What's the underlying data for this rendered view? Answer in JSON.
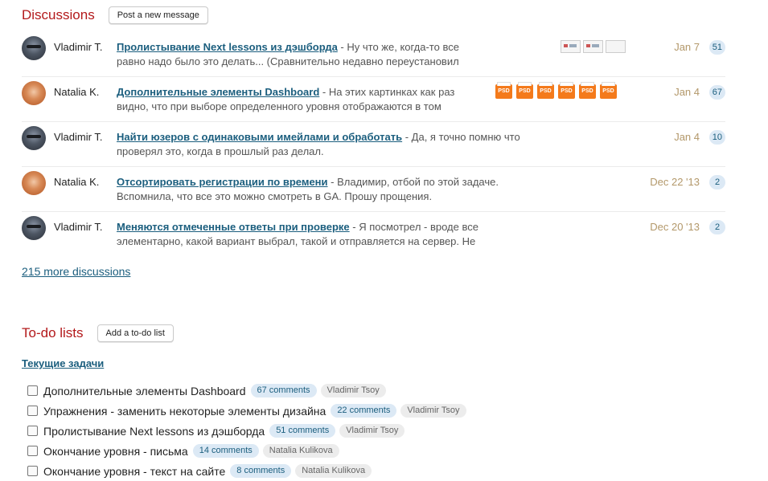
{
  "discussions": {
    "title": "Discussions",
    "post_button": "Post a new message",
    "items": [
      {
        "author": "Vladimir T.",
        "subject": "Пролистывание Next lessons из дэшборда",
        "excerpt": " - Ну что же, когда-то все равно надо было это делать... (Сравнительно недавно переустановил систему; а у меня",
        "date": "Jan 7",
        "count": "51"
      },
      {
        "author": "Natalia K.",
        "subject": "Дополнительные элементы Dashboard",
        "excerpt": " - На этих картинках как раз видно, что при выборе определенного уровня отображаются в том",
        "date": "Jan 4",
        "count": "67",
        "attachment_label": "PSD"
      },
      {
        "author": "Vladimir T.",
        "subject": "Найти юзеров с одинаковыми имейлами и обработать",
        "excerpt": " - Да, я точно помню что проверял это, когда в прошлый раз делал.",
        "date": "Jan 4",
        "count": "10"
      },
      {
        "author": "Natalia K.",
        "subject": "Отсортировать регистрации по времени",
        "excerpt": " - Владимир, отбой по этой задаче. Вспомнила, что все это можно смотреть в GA. Прошу прощения.",
        "date": "Dec 22 '13",
        "count": "2"
      },
      {
        "author": "Vladimir T.",
        "subject": "Меняются отмеченные ответы при проверке",
        "excerpt": " - Я посмотрел - вроде все элементарно, какой вариант выбрал, такой и отправляется на сервер. Не представляю, как может быть по-другому.",
        "date": "Dec 20 '13",
        "count": "2"
      }
    ],
    "more_link": "215 more discussions"
  },
  "todos": {
    "title": "To-do lists",
    "add_button": "Add a to-do list",
    "list_title": "Текущие задачи",
    "items": [
      {
        "label": "Дополнительные элементы Dashboard",
        "comments": "67 comments",
        "assignee": "Vladimir Tsoy"
      },
      {
        "label": "Упражнения - заменить некоторые элементы дизайна",
        "comments": "22 comments",
        "assignee": "Vladimir Tsoy"
      },
      {
        "label": "Пролистывание Next lessons из дэшборда",
        "comments": "51 comments",
        "assignee": "Vladimir Tsoy"
      },
      {
        "label": "Окончание уровня - письма",
        "comments": "14 comments",
        "assignee": "Natalia Kulikova"
      },
      {
        "label": "Окончание уровня - текст на сайте",
        "comments": "8 comments",
        "assignee": "Natalia Kulikova"
      }
    ]
  },
  "colors": {
    "section_title": "#b3191b",
    "link": "#1b5e7e",
    "date": "#b3986a",
    "badge_bg": "#dce9f5"
  }
}
